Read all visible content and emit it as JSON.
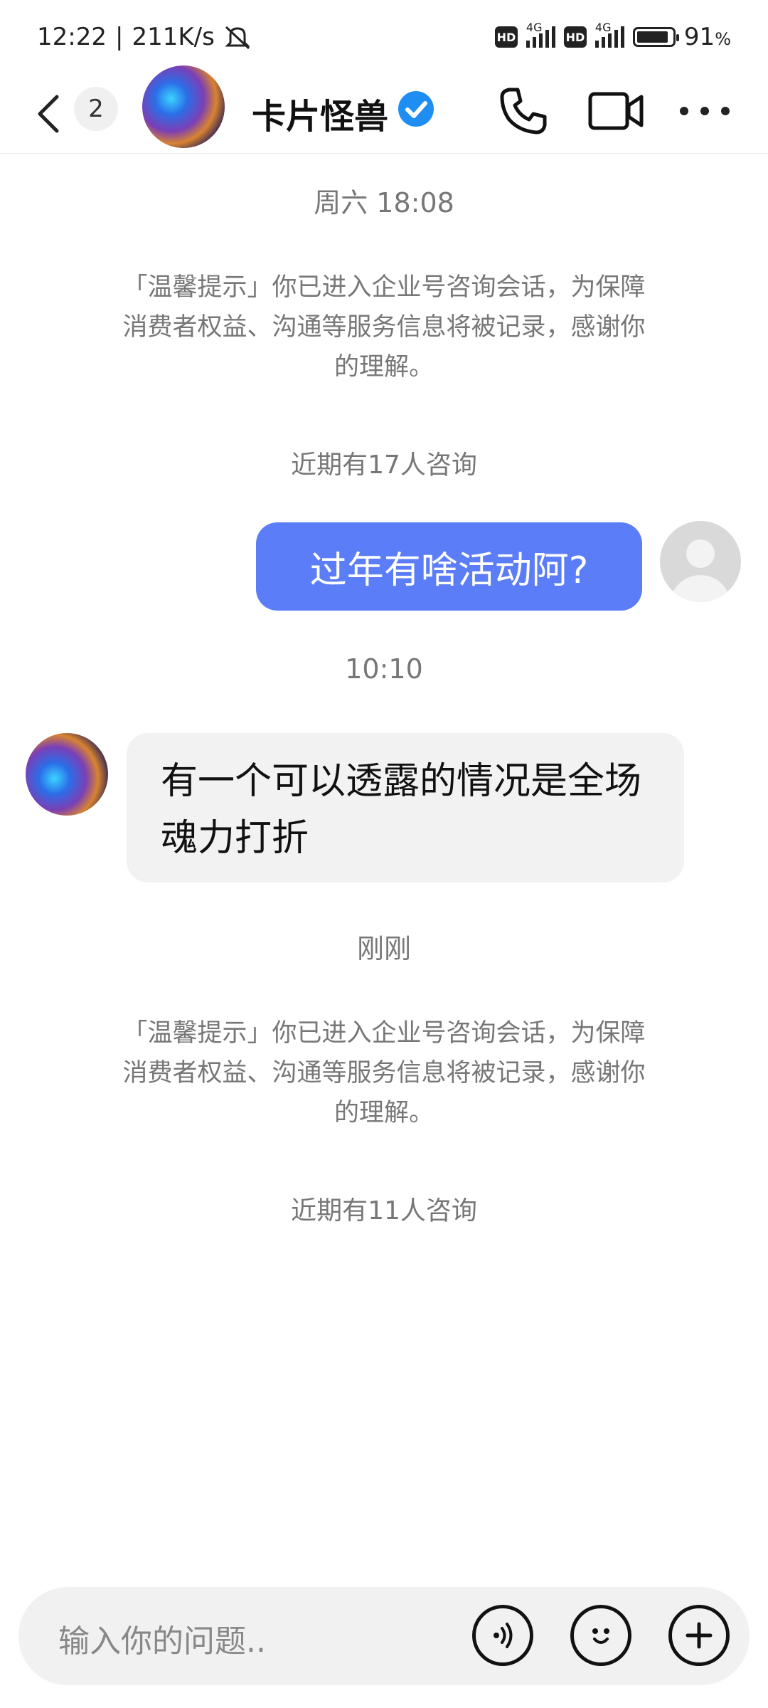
{
  "status_bar": {
    "time": "12:22",
    "speed": "211K/s",
    "hd_label": "HD",
    "network": "4G",
    "battery": "91",
    "battery_unit": "%",
    "battery_level": 0.91
  },
  "header": {
    "unread_count": "2",
    "contact_name": "卡片怪兽"
  },
  "chat": {
    "time_1": "周六 18:08",
    "notice_1": "「温馨提示」你已进入企业号咨询会话，为保障消费者权益、沟通等服务信息将被记录，感谢你的理解。",
    "consult_1": "近期有17人咨询",
    "outgoing_message": "过年有啥活动阿?",
    "time_2": "10:10",
    "incoming_message": "有一个可以透露的情况是全场魂力打折",
    "time_3": "刚刚",
    "notice_2": "「温馨提示」你已进入企业号咨询会话，为保障消费者权益、沟通等服务信息将被记录，感谢你的理解。",
    "consult_2": "近期有11人咨询"
  },
  "input": {
    "placeholder": "输入你的问题.."
  },
  "colors": {
    "accent": "#5b7df7",
    "verified": "#1e8ef3"
  },
  "icons": [
    "back-icon",
    "verified-icon",
    "phone-icon",
    "video-icon",
    "more-icon",
    "voice-icon",
    "emoji-icon",
    "plus-icon",
    "mute-icon"
  ]
}
